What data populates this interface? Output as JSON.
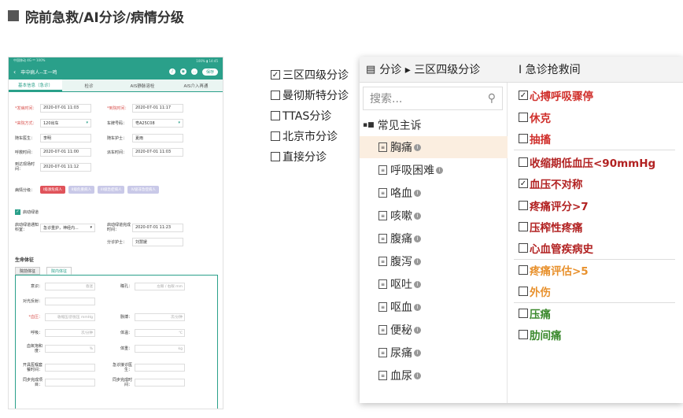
{
  "title": "院前急救/AI分诊/病情分级",
  "phone": {
    "status_left": "中国移动 4G ⁴ᴳ 100%",
    "status_right": "100% ▮ 14:45",
    "patient": "卒中病人--王一鸣",
    "save_label": "保存",
    "tabs": [
      "基本信息（急诊）",
      "检诊",
      "AIS静脉溶栓",
      "AIS介入再通"
    ],
    "fields": [
      {
        "label": "*发病时间：",
        "value": "2020-07-01 11:03",
        "required": true
      },
      {
        "label": "*到院时间：",
        "value": "2020-07-01 11:17",
        "required": true
      },
      {
        "label": "*来院方式：",
        "value": "120出车",
        "required": true,
        "dropdown": true
      },
      {
        "label": "车牌号码：",
        "value": "粤A25C08",
        "dropdown": true
      },
      {
        "label": "随车医生：",
        "value": "李明"
      },
      {
        "label": "随车护士：",
        "value": "夏雨"
      },
      {
        "label": "呼救时间：",
        "value": "2020-07-01 11:00"
      },
      {
        "label": "派车时间：",
        "value": "2020-07-01 11:03"
      },
      {
        "label": "到达现场时间：",
        "value": "2020-07-01 11:12"
      }
    ],
    "grade_label": "病情分级：",
    "grade_buttons": [
      "I级濒危病人",
      "II级危重病人",
      "III级急症病人",
      "IV级非急症病人"
    ],
    "green_channel": "启动绿道",
    "notify_label": "启动绿道通知科室：",
    "notify_value": "急诊重护，神经内...",
    "done_label": "启动绿道完成时间：",
    "done_value": "2020-07-01 11:23",
    "nurse_label": "分诊护士：",
    "nurse_value": "刘慧媛",
    "vitals_title": "生命体征",
    "vitals_tabs": [
      "院前体征",
      "院内体征"
    ],
    "vital_rows": [
      {
        "a": "意识：",
        "av": "昏迷",
        "b": "瞳孔：",
        "bv": "左眼  /  右眼  mm"
      },
      {
        "a": "对光反射：",
        "av": "",
        "b": "",
        "bv": ""
      },
      {
        "a": "*血压：",
        "av": "收缩压/舒张压 mmHg",
        "b": "脉搏：",
        "bv": "次/分钟"
      },
      {
        "a": "呼吸：",
        "av": "次/分钟",
        "b": "体温：",
        "bv": "℃"
      },
      {
        "a": "血氧饱和度：",
        "av": "%",
        "b": "体重：",
        "bv": "kg"
      },
      {
        "a": "开具医嘱套餐时间：",
        "av": "",
        "b": "急诊接诊医生：",
        "bv": ""
      },
      {
        "a": "同步完成项目：",
        "av": "",
        "b": "同步完成时间：",
        "bv": ""
      }
    ]
  },
  "mid_options": [
    {
      "label": "三区四级分诊",
      "checked": true
    },
    {
      "label": "曼彻斯特分诊",
      "checked": false
    },
    {
      "label": "TTAS分诊",
      "checked": false
    },
    {
      "label": "北京市分诊",
      "checked": false
    },
    {
      "label": "直接分诊",
      "checked": false
    }
  ],
  "panel": {
    "crumb": "分诊 ▸  三区四级分诊",
    "right_header": "I 急诊抢救间",
    "search_placeholder": "搜索...",
    "group": "常见主诉",
    "complaints": [
      "胸痛",
      "呼吸困难",
      "咯血",
      "咳嗽",
      "腹痛",
      "腹泻",
      "呕吐",
      "呕血",
      "便秘",
      "尿痛",
      "血尿"
    ],
    "criteria": [
      {
        "label": "心搏呼吸骤停",
        "checked": true,
        "color": "#d0312d"
      },
      {
        "label": "休克",
        "checked": false,
        "color": "#d0312d"
      },
      {
        "label": "抽搐",
        "checked": false,
        "color": "#d0312d"
      },
      {
        "label": "收缩期低血压<90mmHg",
        "checked": false,
        "color": "#b22222"
      },
      {
        "label": "血压不对称",
        "checked": true,
        "color": "#b22222"
      },
      {
        "label": "疼痛评分>7",
        "checked": false,
        "color": "#b22222"
      },
      {
        "label": "压榨性疼痛",
        "checked": false,
        "color": "#b22222"
      },
      {
        "label": "心血管疾病史",
        "checked": false,
        "color": "#b22222"
      },
      {
        "label": "疼痛评估>5",
        "checked": false,
        "color": "#e8912d"
      },
      {
        "label": "外伤",
        "checked": false,
        "color": "#e8912d"
      },
      {
        "label": "压痛",
        "checked": false,
        "color": "#3c8a2e"
      },
      {
        "label": "肋间痛",
        "checked": false,
        "color": "#3c8a2e"
      }
    ]
  }
}
